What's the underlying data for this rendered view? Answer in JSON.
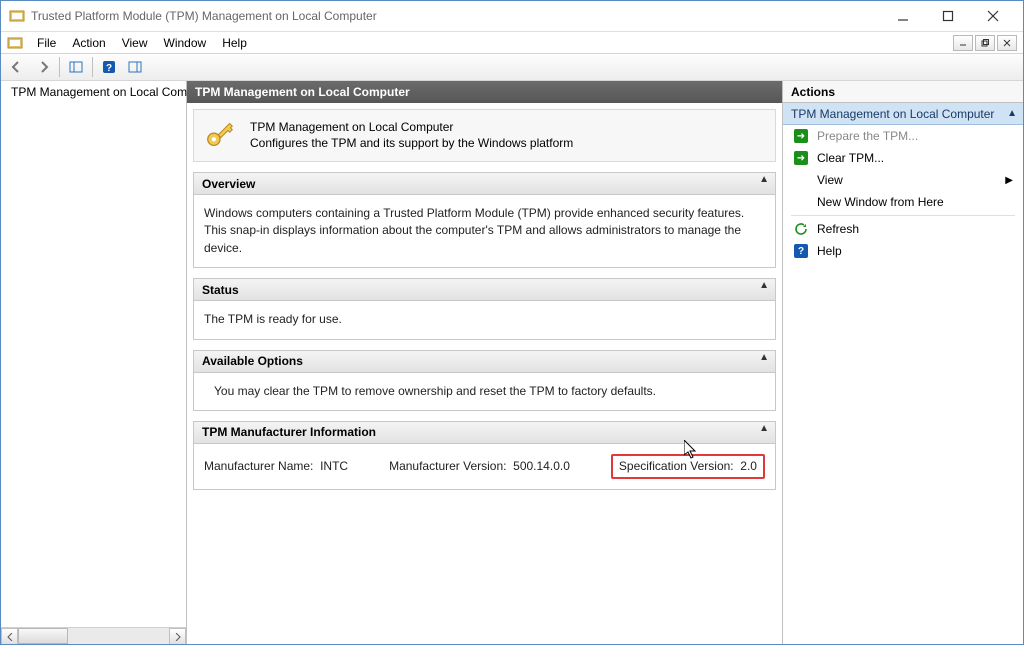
{
  "window": {
    "title": "Trusted Platform Module (TPM) Management on Local Computer"
  },
  "menu": {
    "file": "File",
    "action": "Action",
    "view": "View",
    "window": "Window",
    "help": "Help"
  },
  "tree": {
    "root": "TPM Management on Local Comp"
  },
  "center": {
    "header": "TPM Management on Local Computer",
    "intro_line1": "TPM Management on Local Computer",
    "intro_line2": "Configures the TPM and its support by the Windows platform",
    "overview": {
      "title": "Overview",
      "body": "Windows computers containing a Trusted Platform Module (TPM) provide enhanced security features. This snap-in displays information about the computer's TPM and allows administrators to manage the device."
    },
    "status": {
      "title": "Status",
      "body": "The TPM is ready for use."
    },
    "options": {
      "title": "Available Options",
      "body": "You may clear the TPM to remove ownership and reset the TPM to factory defaults."
    },
    "mfr": {
      "title": "TPM Manufacturer Information",
      "name_label": "Manufacturer Name:",
      "name_value": "INTC",
      "ver_label": "Manufacturer Version:",
      "ver_value": "500.14.0.0",
      "spec_label": "Specification Version:",
      "spec_value": "2.0"
    }
  },
  "actions": {
    "title": "Actions",
    "subtitle": "TPM Management on Local Computer",
    "prepare": "Prepare the TPM...",
    "clear": "Clear TPM...",
    "view": "View",
    "new_window": "New Window from Here",
    "refresh": "Refresh",
    "help": "Help"
  }
}
